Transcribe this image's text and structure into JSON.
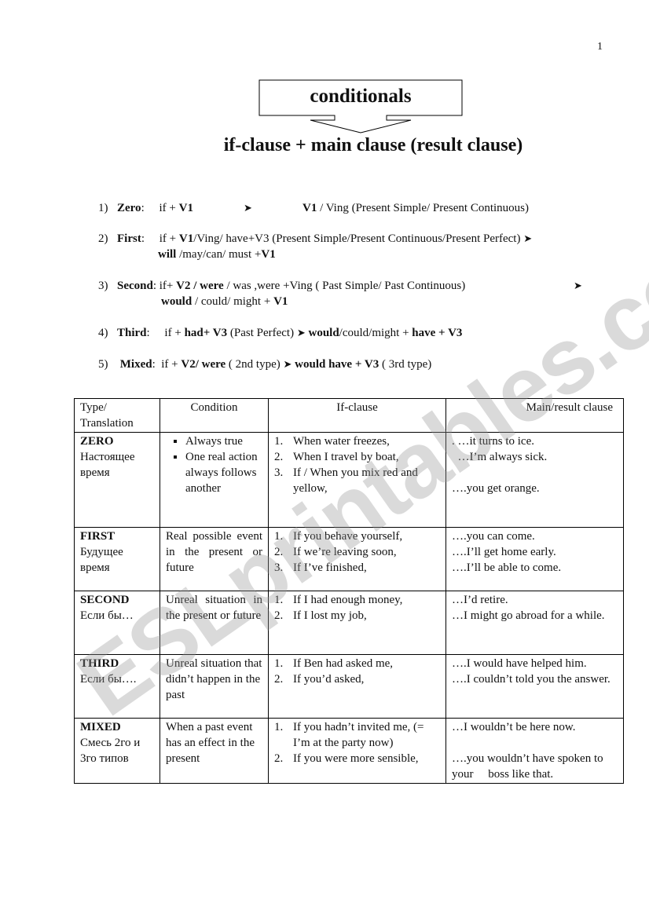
{
  "page_number": "1",
  "title": "conditionals",
  "subtitle": "if-clause + main clause (result clause)",
  "watermark": "ESLprintables.com",
  "rules": [
    {
      "num": "1)",
      "name": "Zero",
      "line1_html": ":&nbsp;&nbsp;&nbsp;&nbsp; if + <b>V1</b>",
      "line1b_html": "<b>V1</b> / Ving (Present Simple/ Present Continuous)",
      "line2_html": ""
    },
    {
      "num": "2)",
      "name": "First",
      "line1_html": ":&nbsp;&nbsp;&nbsp;&nbsp; if + <b>V1</b>/Ving/ have+V3 (Present Simple/Present Continuous/Present Perfect) <span class=\"arrow\">&#10148;</span>",
      "line1b_html": "",
      "line2_html": "<b>will</b> /may/can/ must +<b>V1</b>"
    },
    {
      "num": "3)",
      "name": "Second",
      "line1_html": ": if+ <b>V2 / were</b> / was ,were +Ving ( Past Simple/ Past Continuous)",
      "line1b_html": "",
      "line2_html": "<b>would</b> / could/ might + <b>V1</b>"
    },
    {
      "num": "4)",
      "name": "Third",
      "line1_html": ":&nbsp;&nbsp;&nbsp;&nbsp; if + <b>had+ V3</b> (Past Perfect) <span class=\"arrow\">&#10148;</span> <b>would</b>/could/might + <b>have + V3</b>",
      "line1b_html": "",
      "line2_html": ""
    },
    {
      "num": "5)",
      "name": "Mixed",
      "line1_html": ":&nbsp; if + <b>V2/ were</b> ( 2nd type) <span class=\"arrow\">&#10148;</span> <b>would have + V3</b> ( 3rd type)",
      "line1b_html": "",
      "line2_html": ""
    }
  ],
  "table": {
    "headers": [
      "Type/ Translation",
      "Condition",
      "If-clause",
      "Main/result clause"
    ],
    "header_type_line1": "Type/",
    "header_type_line2": "Translation",
    "rows": [
      {
        "type": "ZERO",
        "translation": "Настоящее время",
        "condition_bullets": [
          "Always true",
          "One real action always follows another"
        ],
        "condition": "",
        "if_clauses": [
          {
            "n": "1.",
            "text": "When water freezes,"
          },
          {
            "n": "2.",
            "text": "When I travel by boat,"
          },
          {
            "n": "3.",
            "text": "If   /   When you mix red and yellow,"
          }
        ],
        "results": [
          ". …it turns to ice.",
          "  …I’m always sick.",
          "",
          "….you get orange."
        ]
      },
      {
        "type": "FIRST",
        "translation": "Будущее время",
        "condition_bullets": [],
        "condition": "Real possible event in the present or future",
        "if_clauses": [
          {
            "n": "1.",
            "text": "If you behave yourself,"
          },
          {
            "n": "2.",
            "text": "If we’re leaving soon,"
          },
          {
            "n": "3.",
            "text": "If I’ve finished,"
          }
        ],
        "results": [
          "….you can come.",
          "….I’ll get home early.",
          "….I’ll be able to come."
        ]
      },
      {
        "type": "SECOND",
        "translation": "Если бы…",
        "condition_bullets": [],
        "condition": "Unreal situation in the present or future",
        "if_clauses": [
          {
            "n": "1.",
            "text": "If I had enough money,"
          },
          {
            "n": "2.",
            "text": "If I lost my job,"
          }
        ],
        "results": [
          "…I’d retire.",
          "…I might go abroad for a while."
        ]
      },
      {
        "type": "THIRD",
        "translation": "Если бы….",
        "condition_bullets": [],
        "condition": "Unreal situation that didn’t happen in the past",
        "if_clauses": [
          {
            "n": "1.",
            "text": "If Ben had asked me,"
          },
          {
            "n": "2.",
            "text": "If you’d asked,"
          }
        ],
        "results": [
          "….I would have helped him.",
          "….I couldn’t told you the answer."
        ]
      },
      {
        "type": "MIXED",
        "translation": "Смесь 2го и 3го типов",
        "condition_bullets": [],
        "condition": "When a past event has an effect in the present",
        "if_clauses": [
          {
            "n": "1.",
            "text": "If you hadn’t invited me, (= I’m at the party now)"
          },
          {
            "n": "2.",
            "text": "If you were more sensible,"
          }
        ],
        "results": [
          "…I wouldn’t be here now.",
          "",
          "….you wouldn’t have spoken to your     boss like that."
        ]
      }
    ]
  }
}
